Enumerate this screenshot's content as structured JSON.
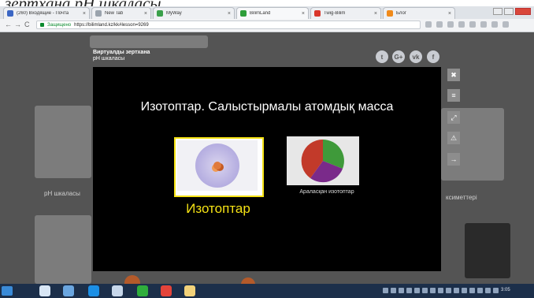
{
  "caption": "зертхана pH шкаласы",
  "browser": {
    "tabs": [
      {
        "label": "(260) Входящие - Почта",
        "favicon_color": "#3a66c4"
      },
      {
        "label": "New Tab",
        "favicon_color": "#9aa3ad"
      },
      {
        "label": "MyWay",
        "favicon_color": "#3aa04a"
      },
      {
        "label": "BilimLand",
        "favicon_color": "#2e9e3a"
      },
      {
        "label": "Twig-Bilim",
        "favicon_color": "#d9362b"
      },
      {
        "label": "Блог",
        "favicon_color": "#f08a1a"
      }
    ],
    "active_tab_index": 3,
    "secure_label": "Защищено",
    "url": "https://bilimland.kz/kk#lesson=9269"
  },
  "page": {
    "header_title": "Виртуалды зертхана",
    "header_subtitle": "pH шкаласы",
    "bg_labels": {
      "left_card": "pH шкаласы",
      "right_card": "ксиметтері"
    },
    "social_icons": [
      "twitter-icon",
      "google-plus-icon",
      "vk-icon",
      "facebook-icon"
    ],
    "social_glyphs": [
      "t",
      "G+",
      "vk",
      "f"
    ],
    "side_buttons": [
      "close-icon",
      "menu-icon",
      "expand-icon",
      "warning-icon",
      "arrow-right-icon"
    ],
    "side_glyphs": [
      "✖",
      "≡",
      "⤢",
      "⚠",
      "→"
    ]
  },
  "modal": {
    "title": "Изотоптар. Салыстырмалы атомдық масса",
    "option_1_label": "Изотоптар",
    "option_2_label": "Араласқан изотоптар"
  },
  "taskbar": {
    "clock": "3:05"
  }
}
